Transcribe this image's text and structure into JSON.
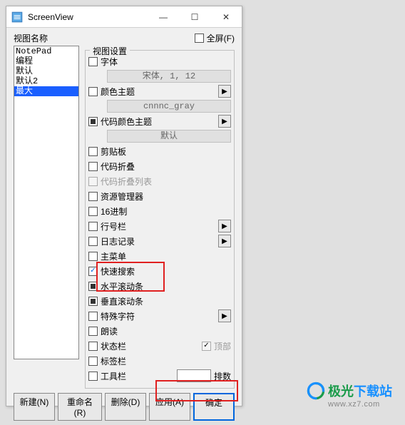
{
  "window": {
    "title": "ScreenView",
    "min": "—",
    "max": "☐",
    "close": "✕"
  },
  "top": {
    "view_name_label": "视图名称",
    "fullscreen_label": "全屏(F)"
  },
  "viewlist": [
    "NotePad",
    "编程",
    "默认",
    "默认2",
    "最大"
  ],
  "viewlist_selected_index": 4,
  "group": {
    "legend": "视图设置",
    "font_label": "字体",
    "font_value": "宋体, 1, 12",
    "color_theme_label": "颜色主题",
    "color_theme_value": "cnnnc_gray",
    "code_color_theme_label": "代码颜色主题",
    "code_color_theme_value": "默认",
    "clipboard_label": "剪贴板",
    "code_fold_label": "代码折叠",
    "code_fold_col_label": "代码折叠列表",
    "explorer_label": "资源管理器",
    "hex_label": "16进制",
    "linenum_label": "行号栏",
    "log_label": "日志记录",
    "mainmenu_label": "主菜单",
    "quicksearch_label": "快速搜索",
    "hscroll_label": "水平滚动条",
    "vscroll_label": "垂直滚动条",
    "special_label": "特殊字符",
    "read_label": "朗读",
    "status_label": "状态栏",
    "top_label": "顶部",
    "tab_label": "标签栏",
    "toolbar_label": "工具栏",
    "rows_label": "排数"
  },
  "buttons": {
    "new": "新建(N)",
    "rename": "重命名(R)",
    "delete": "删除(D)",
    "apply": "应用(A)",
    "ok": "确定"
  },
  "brand": {
    "name_left": "极光",
    "name_right": "下载站",
    "url": "www.xz7.com"
  }
}
